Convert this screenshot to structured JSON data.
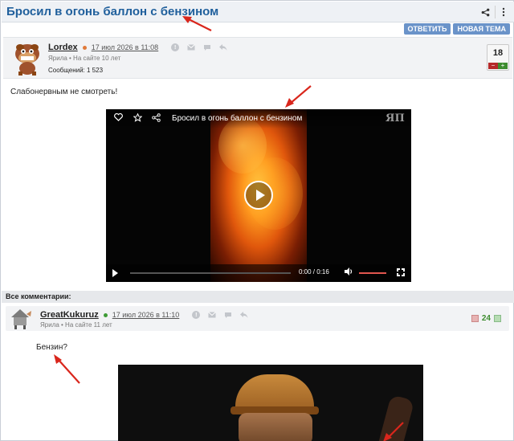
{
  "topic": {
    "title": "Бросил в огонь баллон с бензином",
    "share_icon": "share-icon",
    "menu_icon": "kebab-menu-icon"
  },
  "actions": {
    "reply_label": "ОТВЕТИТЬ",
    "new_topic_label": "НОВАЯ ТЕМА"
  },
  "post": {
    "author": "Lordex",
    "status_color": "#e07a3a",
    "date": "17 июл 2026 в 11:08",
    "sub_line": "Ярила  •  На сайте 10 лет",
    "messages": "Сообщений: 1 523",
    "rating": "18",
    "rating_minus": "−",
    "rating_plus": "+",
    "text": "Слабонервным не смотреть!"
  },
  "video": {
    "title": "Бросил в огонь баллон с бензином",
    "time": "0:00   /   0:16",
    "logo": "ЯП"
  },
  "comments": {
    "header": "Все комментарии:",
    "items": [
      {
        "author": "GreatKukuruz",
        "status_color": "#3d9b35",
        "date": "17 июл 2026 в 11:10",
        "sub_line": "Ярила  •  На сайте 11 лет",
        "score": "24",
        "text": "Бензин?"
      }
    ]
  },
  "colors": {
    "accent": "#1f5f9c",
    "button": "#6a93c9",
    "annotation_arrow": "#d9261c"
  }
}
